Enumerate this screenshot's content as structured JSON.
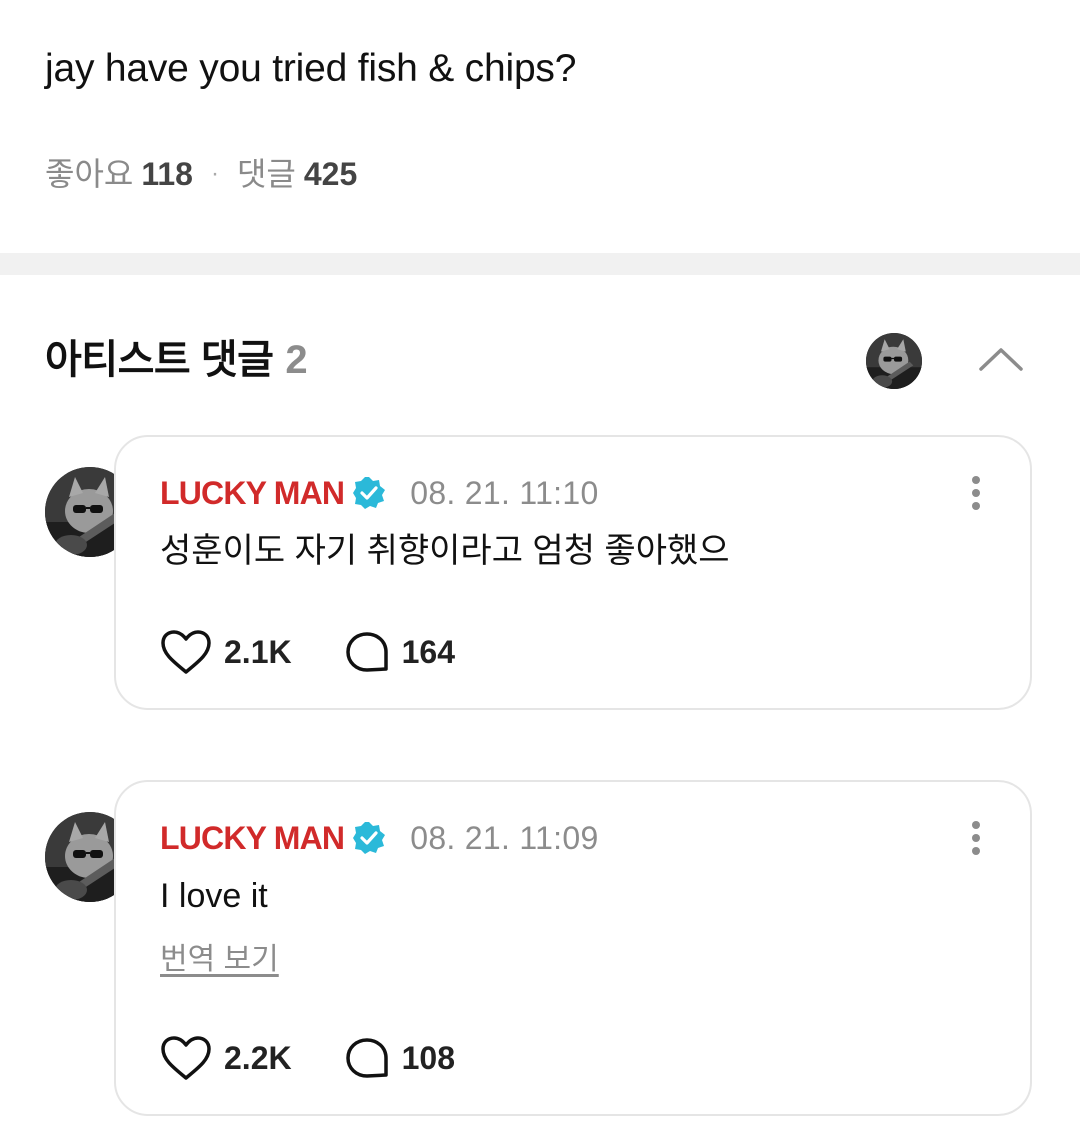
{
  "post": {
    "text": "jay have you tried fish & chips?",
    "likes_label": "좋아요",
    "likes_count": "118",
    "separator": "·",
    "comments_label": "댓글",
    "comments_count": "425"
  },
  "artist_section": {
    "title": "아티스트 댓글",
    "count": "2",
    "collapse_icon": "chevron-up-icon"
  },
  "comments": [
    {
      "author": "LUCKY MAN",
      "verified": true,
      "timestamp": "08. 21. 11:10",
      "text": "성훈이도 자기 취향이라고 엄청 좋아했으",
      "translate_label": "",
      "likes": "2.1K",
      "replies": "164"
    },
    {
      "author": "LUCKY MAN",
      "verified": true,
      "timestamp": "08. 21. 11:09",
      "text": "I love it",
      "translate_label": "번역 보기",
      "likes": "2.2K",
      "replies": "108"
    }
  ],
  "colors": {
    "author": "#d12a2a",
    "verified_badge": "#2bb9d9",
    "muted": "#8c8c8c",
    "divider": "#f1f1f1",
    "card_border": "#e5e5e5"
  }
}
